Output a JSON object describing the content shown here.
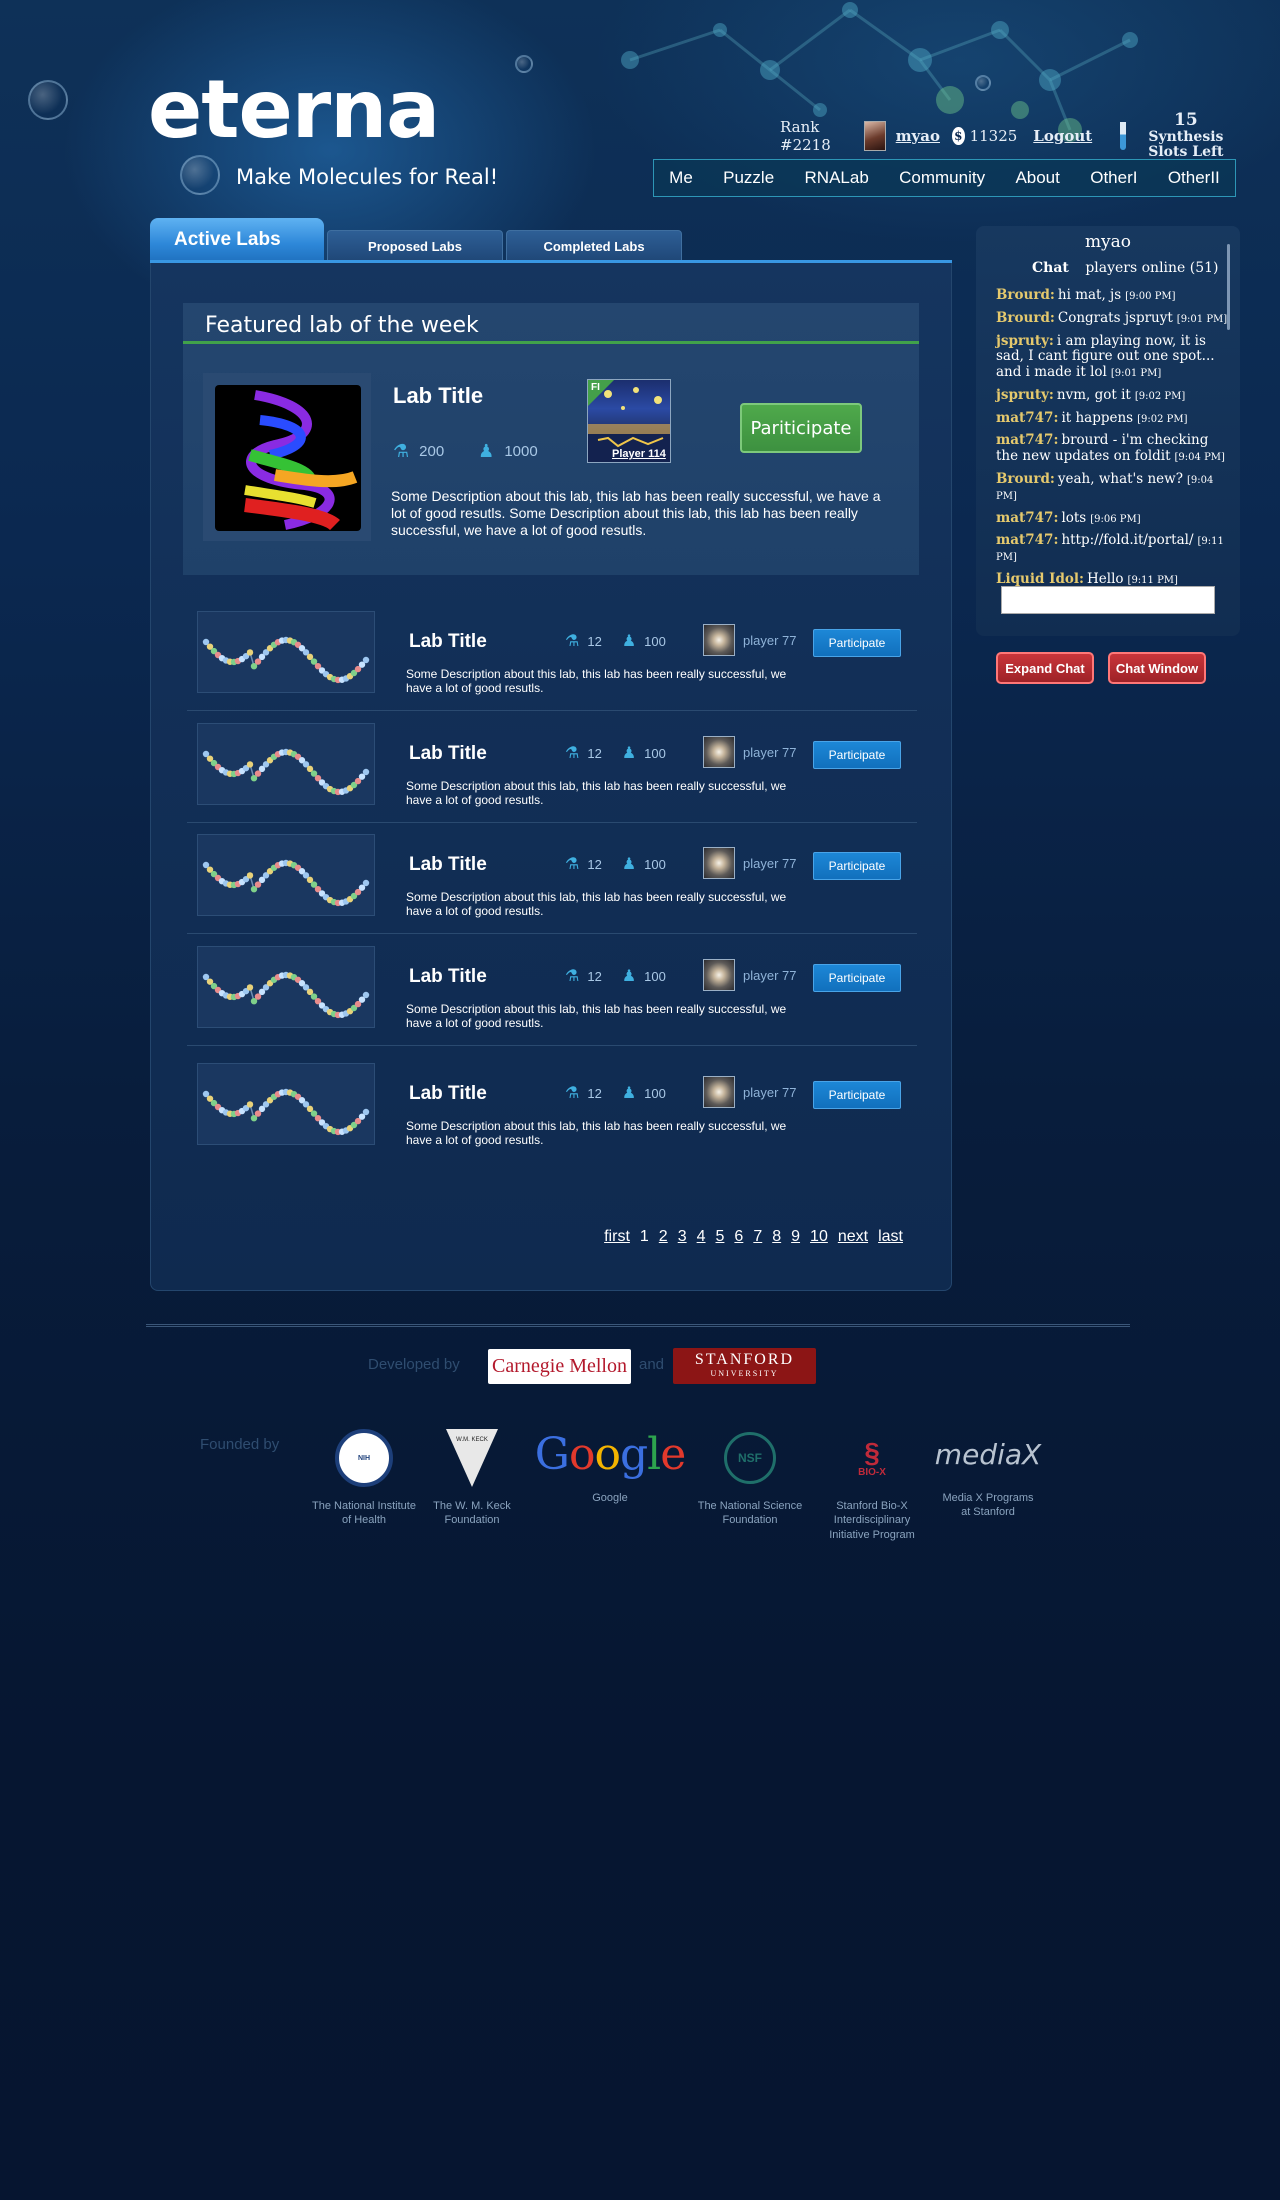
{
  "brand": {
    "logo": "eterna",
    "tagline": "Make Molecules for Real!"
  },
  "userbar": {
    "rank": "Rank #2218",
    "username": "myao",
    "points": "11325",
    "logout": "Logout",
    "slots_count": "15",
    "slots_label": "Synthesis Slots Left"
  },
  "nav": [
    "Me",
    "Puzzle",
    "RNALab",
    "Community",
    "About",
    "OtherI",
    "OtherII"
  ],
  "tabs": {
    "active": "Active Labs",
    "proposed": "Proposed Labs",
    "completed": "Completed Labs"
  },
  "featured": {
    "heading": "Featured lab of the week",
    "title": "Lab Title",
    "stat1": "200",
    "stat2": "1000",
    "flag": "FI",
    "player": "Player 114",
    "button": "Pariticipate",
    "description": "Some Description about this lab, this lab has been really successful, we have a lot of good resutls. Some Description about this lab, this lab has been really successful, we have a lot of good resutls."
  },
  "labs": [
    {
      "title": "Lab Title",
      "stat1": "12",
      "stat2": "100",
      "player": "player 77",
      "button": "Participate",
      "description": "Some Description about this lab, this lab has been really successful, we have a lot of good resutls."
    },
    {
      "title": "Lab Title",
      "stat1": "12",
      "stat2": "100",
      "player": "player 77",
      "button": "Participate",
      "description": "Some Description about this lab, this lab has been really successful, we have a lot of good resutls."
    },
    {
      "title": "Lab Title",
      "stat1": "12",
      "stat2": "100",
      "player": "player 77",
      "button": "Participate",
      "description": "Some Description about this lab, this lab has been really successful, we have a lot of good resutls."
    },
    {
      "title": "Lab Title",
      "stat1": "12",
      "stat2": "100",
      "player": "player 77",
      "button": "Participate",
      "description": "Some Description about this lab, this lab has been really successful, we have a lot of good resutls."
    },
    {
      "title": "Lab Title",
      "stat1": "12",
      "stat2": "100",
      "player": "player 77",
      "button": "Participate",
      "description": "Some Description about this lab, this lab has been really successful, we have a lot of good resutls."
    }
  ],
  "pager": [
    "first",
    "1",
    "2",
    "3",
    "4",
    "5",
    "6",
    "7",
    "8",
    "9",
    "10",
    "next",
    "last"
  ],
  "chat": {
    "user": "myao",
    "label": "Chat",
    "online": "players online (51)",
    "messages": [
      {
        "who": "Brourd:",
        "text": "hi mat, js",
        "ts": "[9:00 PM]"
      },
      {
        "who": "Brourd:",
        "text": "Congrats jspruyt",
        "ts": "[9:01 PM]"
      },
      {
        "who": "jspruty:",
        "text": "i am playing now, it is sad, I cant figure out one spot... and i made it lol",
        "ts": "[9:01 PM]"
      },
      {
        "who": "jspruty:",
        "text": "nvm, got it",
        "ts": "[9:02 PM]"
      },
      {
        "who": "mat747:",
        "text": "it happens",
        "ts": "[9:02 PM]"
      },
      {
        "who": "mat747:",
        "text": "brourd - i'm checking the new updates on foldit",
        "ts": "[9:04 PM]"
      },
      {
        "who": "Brourd:",
        "text": "yeah, what's new?",
        "ts": "[9:04 PM]"
      },
      {
        "who": "mat747:",
        "text": "lots",
        "ts": "[9:06 PM]"
      },
      {
        "who": "mat747:",
        "text": "http://fold.it/portal/",
        "ts": "[9:11 PM]"
      },
      {
        "who": "Liquid Idol:",
        "text": "Hello",
        "ts": "[9:11 PM]"
      }
    ],
    "expand": "Expand Chat",
    "window": "Chat Window"
  },
  "footer": {
    "developed_by": "Developed by",
    "and": "and",
    "cmu": "Carnegie Mellon",
    "stanford": "STANFORD",
    "stanford_sub": "UNIVERSITY",
    "founded_by": "Founded by",
    "sponsors": [
      {
        "logo": "NIH",
        "line1": "The National Institute",
        "line2": "of Health",
        "line3": ""
      },
      {
        "logo": "W.M. KECK",
        "line1": "The W. M. Keck",
        "line2": "Foundation",
        "line3": ""
      },
      {
        "logo": "Google",
        "line1": "Google",
        "line2": "",
        "line3": ""
      },
      {
        "logo": "NSF",
        "line1": "The National Science",
        "line2": "Foundation",
        "line3": ""
      },
      {
        "logo": "BIO-X",
        "line1": "Stanford Bio-X",
        "line2": "Interdisciplinary",
        "line3": "Initiative Program"
      },
      {
        "logo": "mediaX",
        "line1": "Media X Programs",
        "line2": "at Stanford",
        "line3": ""
      }
    ]
  }
}
